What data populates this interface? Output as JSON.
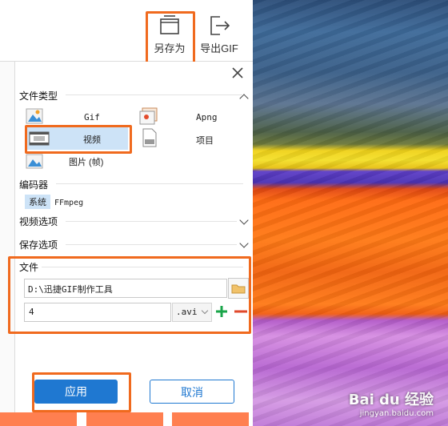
{
  "toolbar": {
    "save_as_label": "另存为",
    "export_gif_label": "导出GIF"
  },
  "panel": {
    "file_type": {
      "title": "文件类型",
      "options": [
        {
          "label": "Gif",
          "icon": "image-icon"
        },
        {
          "label": "Apng",
          "icon": "image-stack-icon"
        },
        {
          "label": "视频",
          "icon": "film-icon",
          "selected": true
        },
        {
          "label": "项目",
          "icon": "document-icon"
        },
        {
          "label": "图片 (帧)",
          "icon": "landscape-icon"
        }
      ]
    },
    "encoder": {
      "title": "编码器",
      "options": [
        "系统",
        "FFmpeg"
      ],
      "selected": "系统"
    },
    "video_options": {
      "title": "视频选项"
    },
    "save_options": {
      "title": "保存选项"
    },
    "file": {
      "title": "文件",
      "path": "D:\\迅捷GIF制作工具",
      "name": "4",
      "extension": ".avi"
    },
    "buttons": {
      "apply": "应用",
      "cancel": "取消"
    }
  },
  "watermark": {
    "brand": "Bai du 经验",
    "url": "jingyan.baidu.com"
  },
  "colors": {
    "accent_blue": "#1f78d1",
    "highlight_orange": "#f06a1e",
    "selected_bg": "#cde3f7",
    "add_green": "#1aa54a",
    "remove_red": "#e04a2c"
  }
}
